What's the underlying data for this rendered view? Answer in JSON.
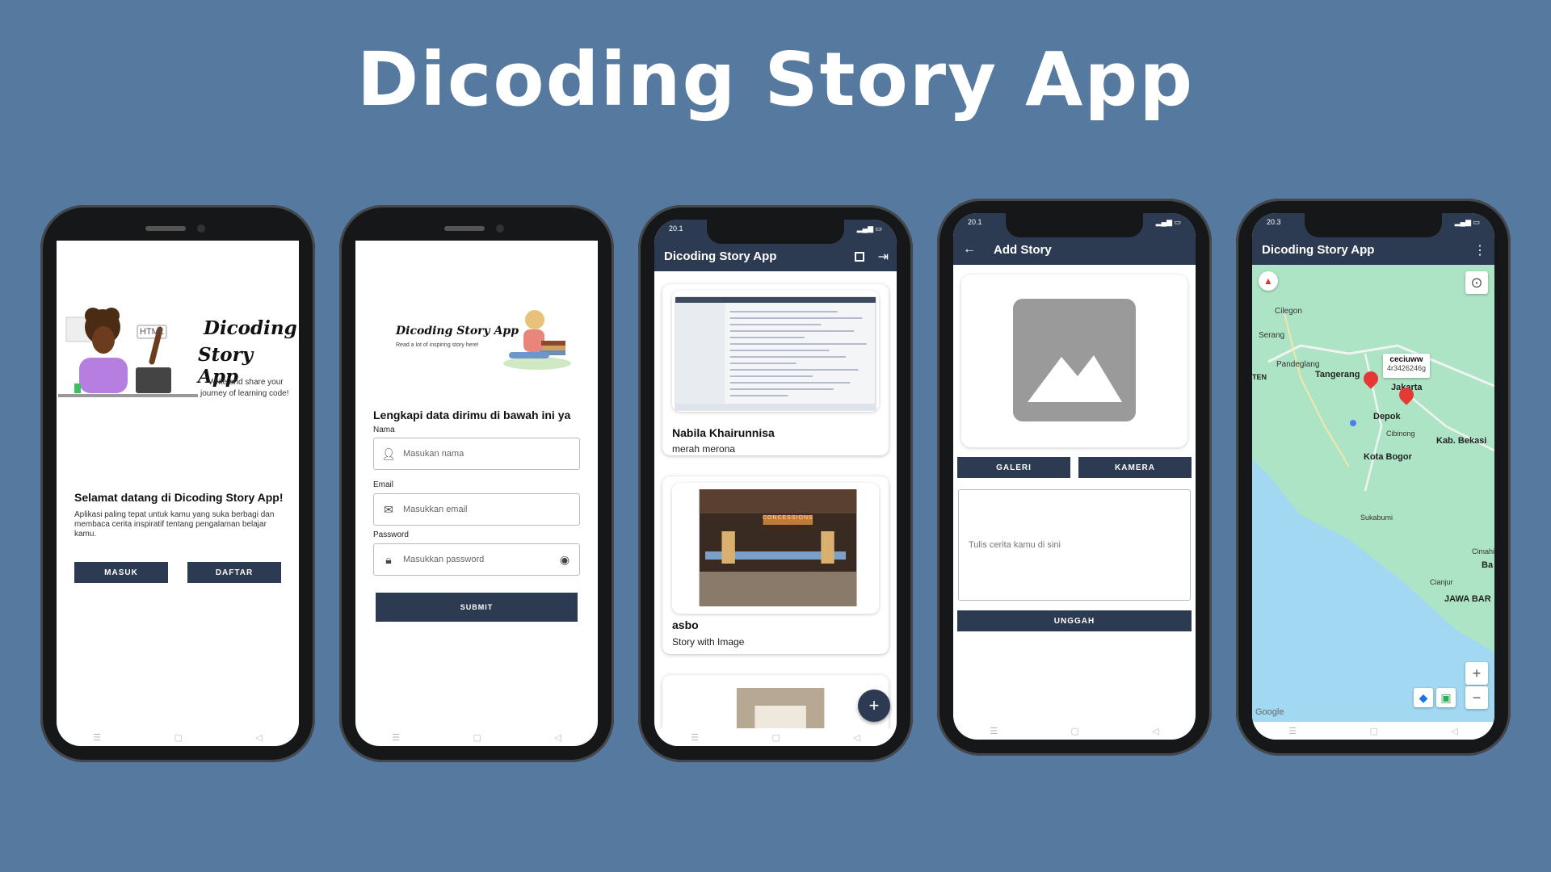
{
  "headline": "Dicoding Story App",
  "nav_icons": {
    "menu": "☰",
    "home": "▢",
    "back": "◁"
  },
  "welcome": {
    "logo_line1": "Dicoding",
    "logo_line2": "Story App",
    "logo_tagline1": "Write and share your",
    "logo_tagline2": "journey of learning code!",
    "html_tag": "HTML",
    "heading": "Selamat datang di Dicoding Story App!",
    "body": "Aplikasi paling tepat untuk kamu yang suka berbagi dan membaca cerita inspiratif tentang pengalaman belajar kamu.",
    "login_label": "MASUK",
    "register_label": "DAFTAR"
  },
  "register": {
    "logo_title": "Dicoding Story App",
    "logo_tagline": "Read a lot of inspiring story here!",
    "heading": "Lengkapi data dirimu di bawah ini ya",
    "name_label": "Nama",
    "name_placeholder": "Masukan nama",
    "email_label": "Email",
    "email_placeholder": "Masukkan email",
    "password_label": "Password",
    "password_placeholder": "Masukkan password",
    "submit_label": "SUBMIT"
  },
  "list": {
    "status_time": "20.1",
    "title": "Dicoding Story App",
    "stories": [
      {
        "name": "Nabila Khairunnisa",
        "description": "merah merona"
      },
      {
        "name": "asbo",
        "description": "Story with Image"
      }
    ],
    "concessions_sign": "CONCESSIONS",
    "fab_label": "+"
  },
  "add_story": {
    "status_time": "20.1",
    "back_icon": "←",
    "title": "Add Story",
    "gallery_label": "GALERI",
    "camera_label": "KAMERA",
    "story_placeholder": "Tulis cerita kamu di sini",
    "upload_label": "UNGGAH"
  },
  "map": {
    "status_time": "20.3",
    "title": "Dicoding Story App",
    "more_icon": "⋮",
    "compass_icon": "⊙",
    "zoom_in": "+",
    "zoom_out": "−",
    "marker_title": "ceciuww",
    "marker_snippet": "4r3426246g",
    "attribution": "Google",
    "places": [
      "Cilegon",
      "Serang",
      "Pandeglang",
      "Tangerang",
      "Jakarta",
      "Depok",
      "Cibinong",
      "Kab. Bekasi",
      "Kota Bogor",
      "Sukabumi",
      "Cimahi",
      "Cianjur",
      "JAWA BAR",
      "TEN",
      "Ba"
    ]
  },
  "colors": {
    "background": "#56799f",
    "app_dark": "#2d3b52",
    "map_land": "#aee4c6",
    "map_sea": "#a2d8f2"
  }
}
